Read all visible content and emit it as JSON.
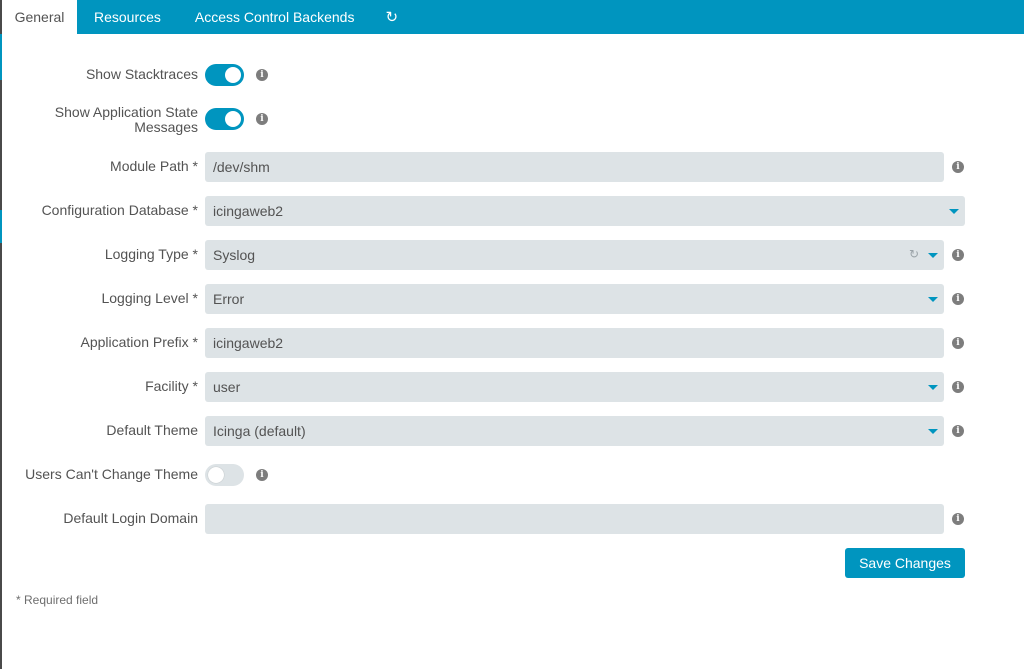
{
  "tabs": [
    {
      "label": "General",
      "active": true
    },
    {
      "label": "Resources",
      "active": false
    },
    {
      "label": "Access Control Backends",
      "active": false
    }
  ],
  "refresh_icon": "↻",
  "colors": {
    "accent": "#0095bf",
    "field_bg": "#dde3e6",
    "text": "#535353"
  },
  "form": {
    "show_stacktraces": {
      "label": "Show Stacktraces",
      "checked": true
    },
    "show_app_state": {
      "label": "Show Application State Messages",
      "checked": true
    },
    "module_path": {
      "label": "Module Path *",
      "value": "/dev/shm"
    },
    "config_db": {
      "label": "Configuration Database *",
      "value": "icingaweb2"
    },
    "logging_type": {
      "label": "Logging Type *",
      "value": "Syslog"
    },
    "logging_level": {
      "label": "Logging Level *",
      "value": "Error"
    },
    "app_prefix": {
      "label": "Application Prefix *",
      "value": "icingaweb2"
    },
    "facility": {
      "label": "Facility *",
      "value": "user"
    },
    "default_theme": {
      "label": "Default Theme",
      "value": "Icinga (default)"
    },
    "users_cant_change_theme": {
      "label": "Users Can't Change Theme",
      "checked": false
    },
    "default_login_domain": {
      "label": "Default Login Domain",
      "value": ""
    }
  },
  "save_label": "Save Changes",
  "required_note": "* Required field",
  "info_glyph": "i"
}
